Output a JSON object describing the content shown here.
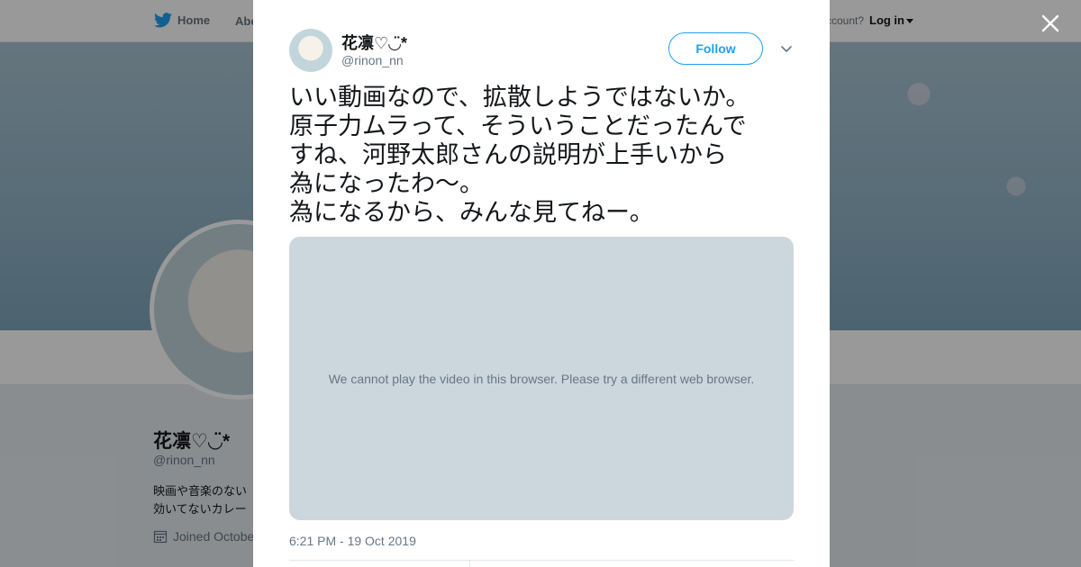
{
  "nav": {
    "home_label": "Home",
    "about_label": "Abo",
    "account_prompt": "ccount?",
    "login_label": "Log in"
  },
  "profile": {
    "name": "花凛♡◡̈*",
    "handle": "@rinon_nn",
    "bio_line1": "映画や音楽のない",
    "bio_line2": "効いてないカレー",
    "joined": "Joined Octobe"
  },
  "modal": {
    "author_name": "花凛♡◡̈*",
    "author_handle": "@rinon_nn",
    "follow_label": "Follow",
    "tweet_lines": [
      "いい動画なので、拡散しようではないか。",
      "原子力ムラって、そういうことだったんで",
      "すね、河野太郎さんの説明が上手いから",
      "為になったわ〜。",
      "為になるから、みんな見てねー。"
    ],
    "video_message": "We cannot play the video in this browser. Please try a different web browser.",
    "timestamp": "6:21 PM - 19 Oct 2019"
  },
  "icons": {
    "bird": "twitter-bird-icon",
    "close": "close-icon",
    "chevron": "chevron-down-icon",
    "calendar": "calendar-icon"
  },
  "colors": {
    "brand_blue": "#1da1f2",
    "text_primary": "#14171a",
    "text_secondary": "#657786",
    "video_bg": "#ccd6dd"
  }
}
